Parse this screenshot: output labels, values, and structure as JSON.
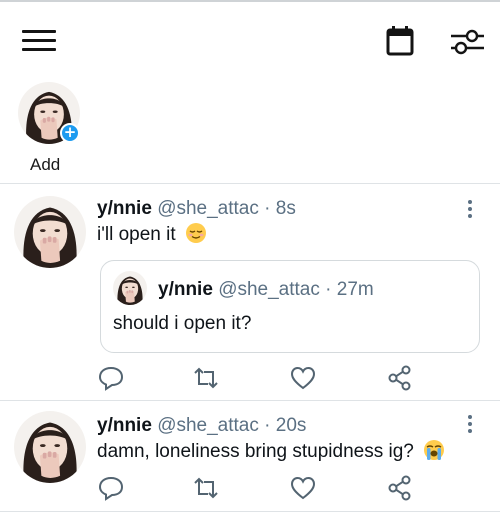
{
  "stories": {
    "add_label": "Add"
  },
  "icons": {
    "menu": "hamburger-menu-icon",
    "calendar": "calendar-icon",
    "filter": "sliders-icon",
    "reply": "reply-icon",
    "retweet": "retweet-icon",
    "like": "heart-icon",
    "share": "share-icon"
  },
  "colors": {
    "accent": "#1d9bf0",
    "text": "#0f1419",
    "muted": "#5b7083",
    "divider": "#dfe3e6"
  },
  "tweets": [
    {
      "name": "y/nnie",
      "meta": "@she_attac · 8s",
      "text": "i'll open it",
      "emoji": "relieved-face",
      "quote": {
        "name": "y/nnie",
        "meta": "@she_attac · 27m",
        "text": "should i open it?"
      }
    },
    {
      "name": "y/nnie",
      "meta": "@she_attac · 20s",
      "text": "damn, loneliness bring stupidness ig?",
      "emoji": "loudly-crying-face"
    }
  ]
}
